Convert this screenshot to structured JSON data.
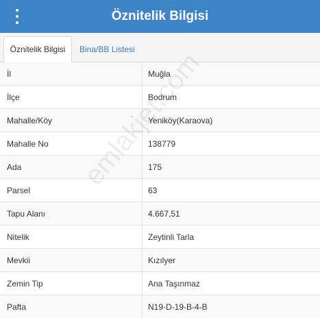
{
  "header": {
    "title": "Öznitelik Bilgisi",
    "menu_icon": "vertical-dots-icon",
    "background": "#3d85c6"
  },
  "tabs": [
    {
      "label": "Öznitelik Bilgisi",
      "active": true
    },
    {
      "label": "Bina/BB Listesi",
      "active": false
    }
  ],
  "rows": [
    {
      "label": "İl",
      "value": "Muğla"
    },
    {
      "label": "İlçe",
      "value": "Bodrum"
    },
    {
      "label": "Mahalle/Köy",
      "value": "Yeniköy(Karaova)"
    },
    {
      "label": "Mahalle No",
      "value": "138779"
    },
    {
      "label": "Ada",
      "value": "175"
    },
    {
      "label": "Parsel",
      "value": "63"
    },
    {
      "label": "Tapu Alanı",
      "value": "4.667,51"
    },
    {
      "label": "Nitelik",
      "value": "Zeytinli Tarla"
    },
    {
      "label": "Mevkii",
      "value": "Kızılyer"
    },
    {
      "label": "Zemin Tip",
      "value": "Ana Taşınmaz"
    },
    {
      "label": "Pafta",
      "value": "N19-D-19-B-4-B"
    }
  ],
  "watermark": "emlakjet.com"
}
